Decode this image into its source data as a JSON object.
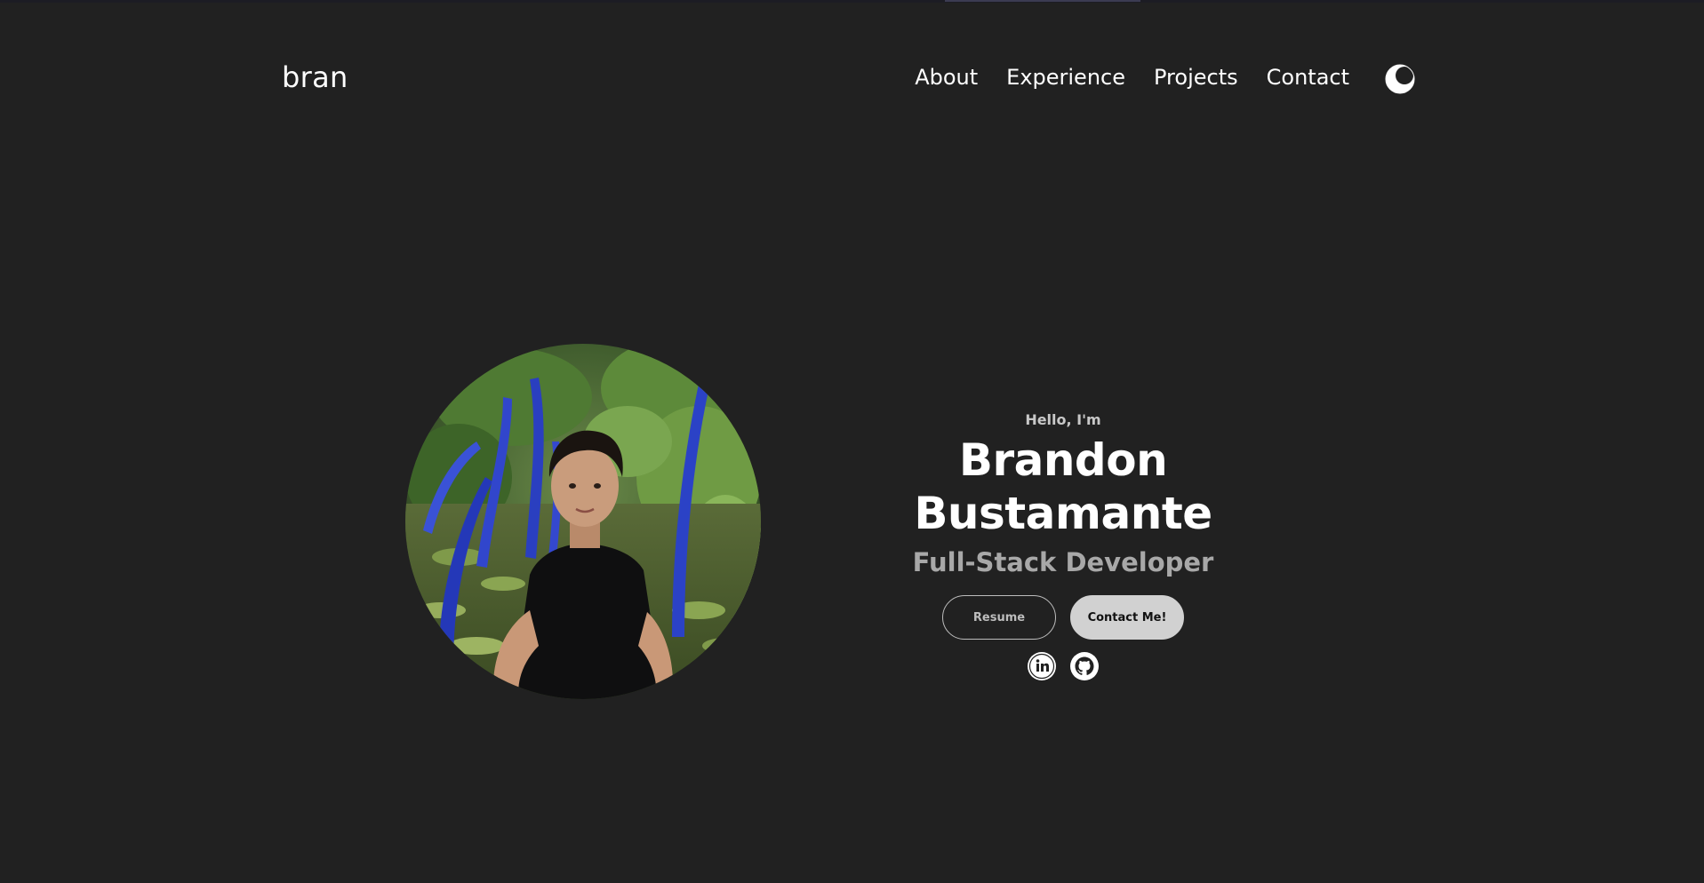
{
  "nav": {
    "logo": "bran",
    "links": [
      "About",
      "Experience",
      "Projects",
      "Contact"
    ],
    "theme_toggle_icon": "moon-icon"
  },
  "hero": {
    "greeting": "Hello, I'm",
    "name": "Brandon Bustamante",
    "role": "Full-Stack Developer",
    "buttons": {
      "resume": "Resume",
      "contact": "Contact Me!"
    },
    "socials": {
      "linkedin_icon": "linkedin-icon",
      "github_icon": "github-icon"
    },
    "portrait_icon": "profile-photo"
  },
  "colors": {
    "background": "#212121",
    "text": "#ffffff",
    "muted": "#a8a8a8",
    "button_solid": "#d1d1d1"
  }
}
